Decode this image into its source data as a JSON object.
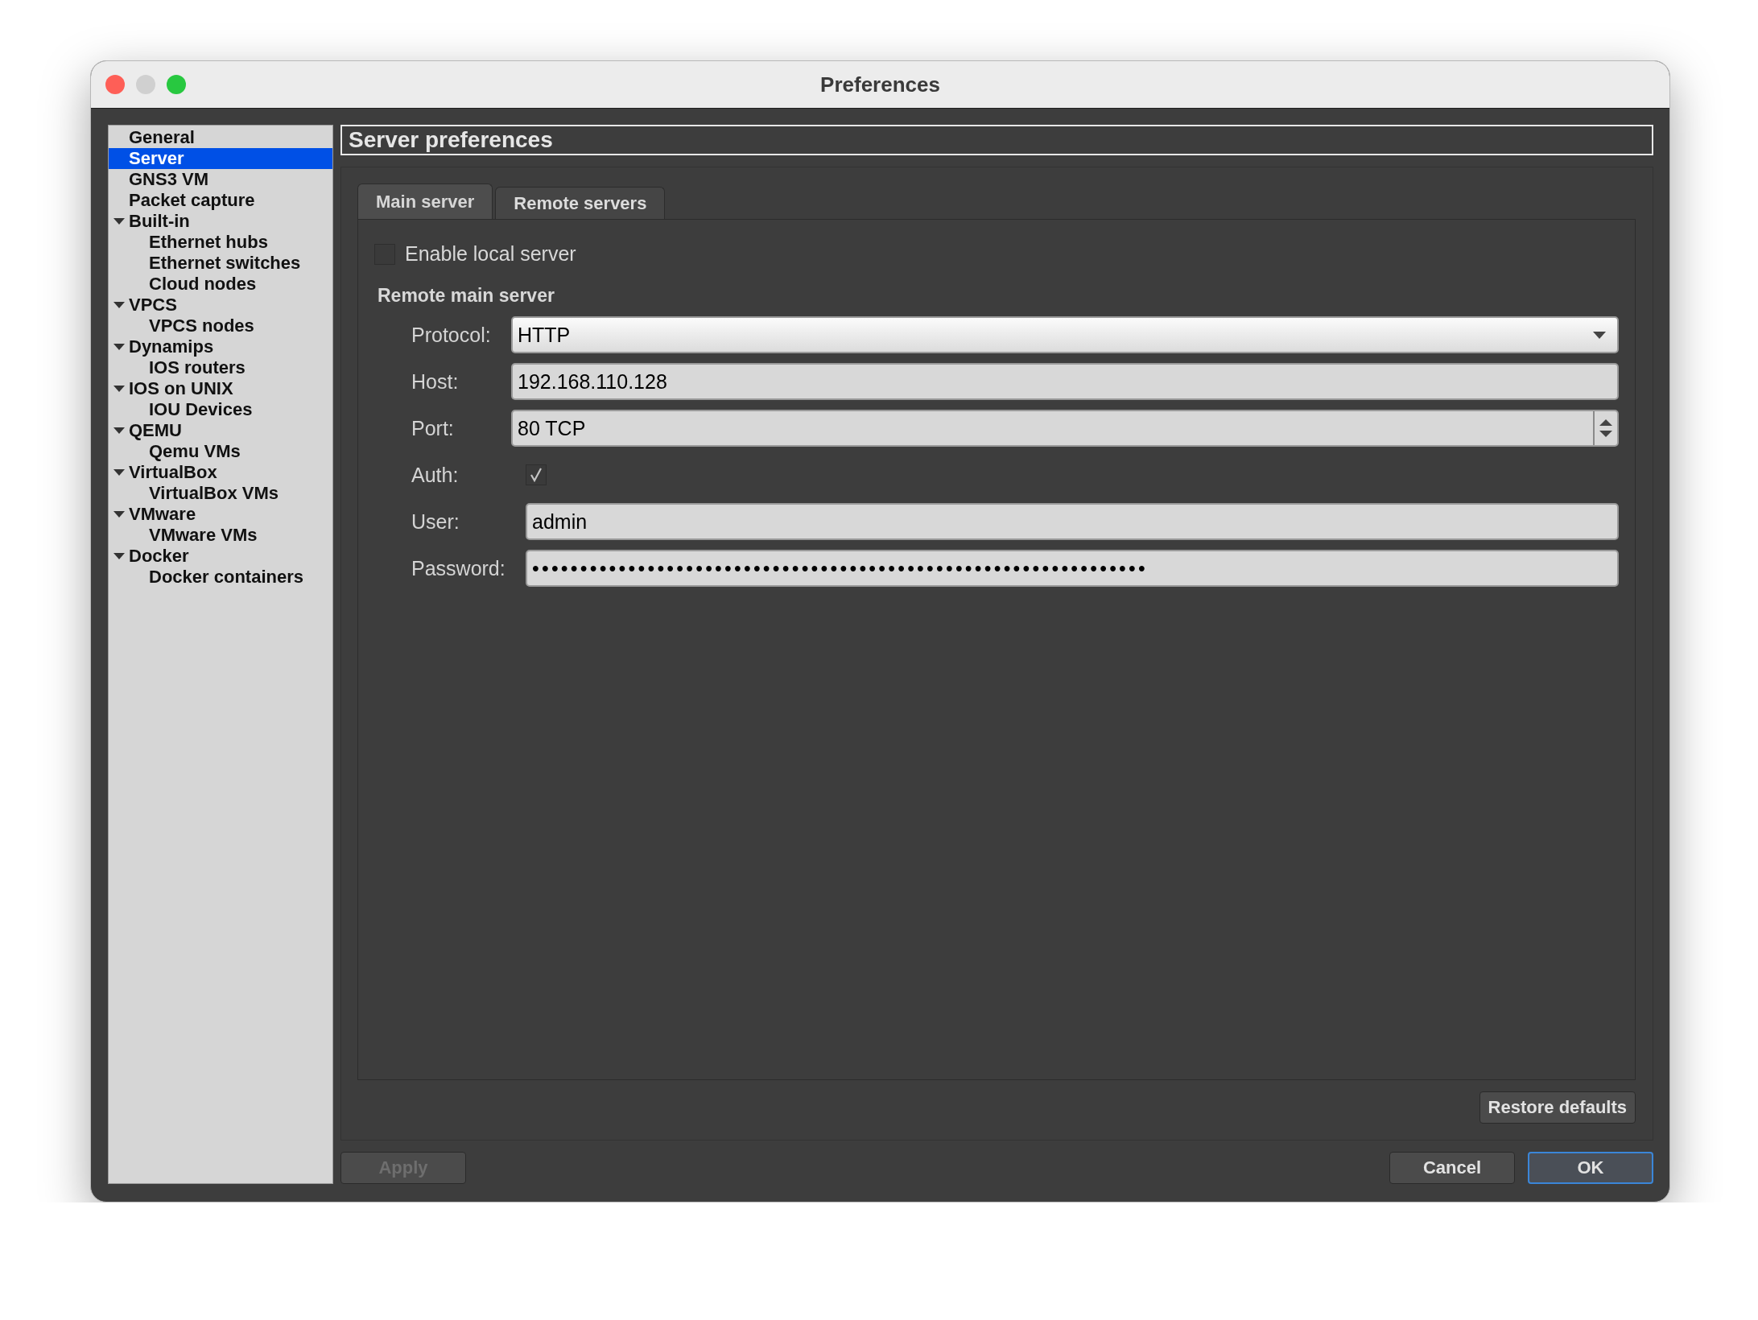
{
  "window": {
    "title": "Preferences"
  },
  "sidebar": {
    "items": [
      {
        "label": "General",
        "selected": false
      },
      {
        "label": "Server",
        "selected": true
      },
      {
        "label": "GNS3 VM",
        "selected": false
      },
      {
        "label": "Packet capture",
        "selected": false
      },
      {
        "label": "Built-in",
        "selected": false,
        "expanded": true,
        "children": [
          {
            "label": "Ethernet hubs",
            "selected": false
          },
          {
            "label": "Ethernet switches",
            "selected": false
          },
          {
            "label": "Cloud nodes",
            "selected": false
          }
        ]
      },
      {
        "label": "VPCS",
        "selected": false,
        "expanded": true,
        "children": [
          {
            "label": "VPCS nodes",
            "selected": false
          }
        ]
      },
      {
        "label": "Dynamips",
        "selected": false,
        "expanded": true,
        "children": [
          {
            "label": "IOS routers",
            "selected": false
          }
        ]
      },
      {
        "label": "IOS on UNIX",
        "selected": false,
        "expanded": true,
        "children": [
          {
            "label": "IOU Devices",
            "selected": false
          }
        ]
      },
      {
        "label": "QEMU",
        "selected": false,
        "expanded": true,
        "children": [
          {
            "label": "Qemu VMs",
            "selected": false
          }
        ]
      },
      {
        "label": "VirtualBox",
        "selected": false,
        "expanded": true,
        "children": [
          {
            "label": "VirtualBox VMs",
            "selected": false
          }
        ]
      },
      {
        "label": "VMware",
        "selected": false,
        "expanded": true,
        "children": [
          {
            "label": "VMware VMs",
            "selected": false
          }
        ]
      },
      {
        "label": "Docker",
        "selected": false,
        "expanded": true,
        "children": [
          {
            "label": "Docker containers",
            "selected": false
          }
        ]
      }
    ]
  },
  "panel": {
    "title": "Server preferences",
    "tabs": [
      {
        "label": "Main server",
        "selected": true
      },
      {
        "label": "Remote servers",
        "selected": false
      }
    ],
    "enable_local_server": {
      "label": "Enable local server",
      "checked": false
    },
    "section_title": "Remote main server",
    "fields": [
      {
        "kind": "combo",
        "label": "Protocol:",
        "value": "HTTP"
      },
      {
        "kind": "text",
        "label": "Host:",
        "value": "192.168.110.128"
      },
      {
        "kind": "spin",
        "label": "Port:",
        "value": "80 TCP"
      },
      {
        "kind": "checkbox",
        "label": "Auth:",
        "checked": true
      },
      {
        "kind": "text",
        "label": "User:",
        "value": "admin"
      },
      {
        "kind": "text",
        "label": "Password:",
        "value": "••••••••••••••••••••••••••••••••••••••••••••••••••••••••••••••••"
      }
    ],
    "restore_button": "Restore defaults"
  },
  "buttons": [
    {
      "label": "Apply",
      "disabled": true,
      "default": false
    },
    {
      "label": "Cancel",
      "disabled": false,
      "default": false
    },
    {
      "label": "OK",
      "disabled": false,
      "default": true
    }
  ]
}
